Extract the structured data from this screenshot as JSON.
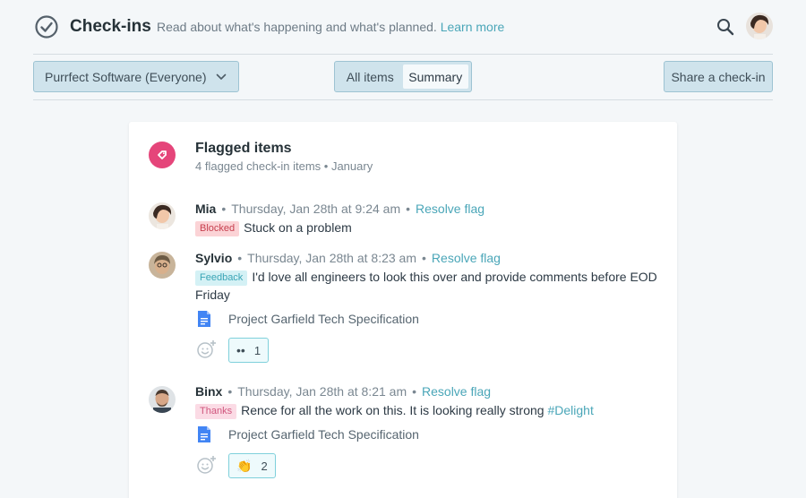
{
  "header": {
    "title": "Check-ins",
    "subtitle": "Read about what's happening and what's planned.",
    "learn_more": "Learn more"
  },
  "toolbar": {
    "project_select": "Purrfect Software (Everyone)",
    "view_all": "All items",
    "view_summary": "Summary",
    "share_button": "Share a check-in"
  },
  "card": {
    "title": "Flagged items",
    "subtitle": "4 flagged check-in items • January",
    "accent_color": "#e5457a"
  },
  "entries": [
    {
      "name": "Mia",
      "time": "Thursday, Jan 28th at 9:24 am",
      "action": "Resolve flag",
      "tag": "Blocked",
      "text": "Stuck on a problem"
    },
    {
      "name": "Sylvio",
      "time": "Thursday, Jan 28th at 8:23 am",
      "action": "Resolve flag",
      "tag": "Feedback",
      "text": "I'd love all engineers to look this over and provide comments before EOD Friday",
      "attachment": "Project Garfield Tech Specification",
      "reaction": {
        "emoji": "••",
        "count": "1"
      }
    },
    {
      "name": "Binx",
      "time": "Thursday, Jan 28th at 8:21 am",
      "action": "Resolve flag",
      "tag": "Thanks",
      "text": "Rence for all the work on this. It is looking really strong",
      "hashtag": "#Delight",
      "attachment": "Project Garfield Tech Specification",
      "reaction": {
        "emoji": "👏",
        "count": "2"
      }
    }
  ],
  "colors": {
    "link": "#4aa6b8",
    "background": "#f4f7f9"
  }
}
